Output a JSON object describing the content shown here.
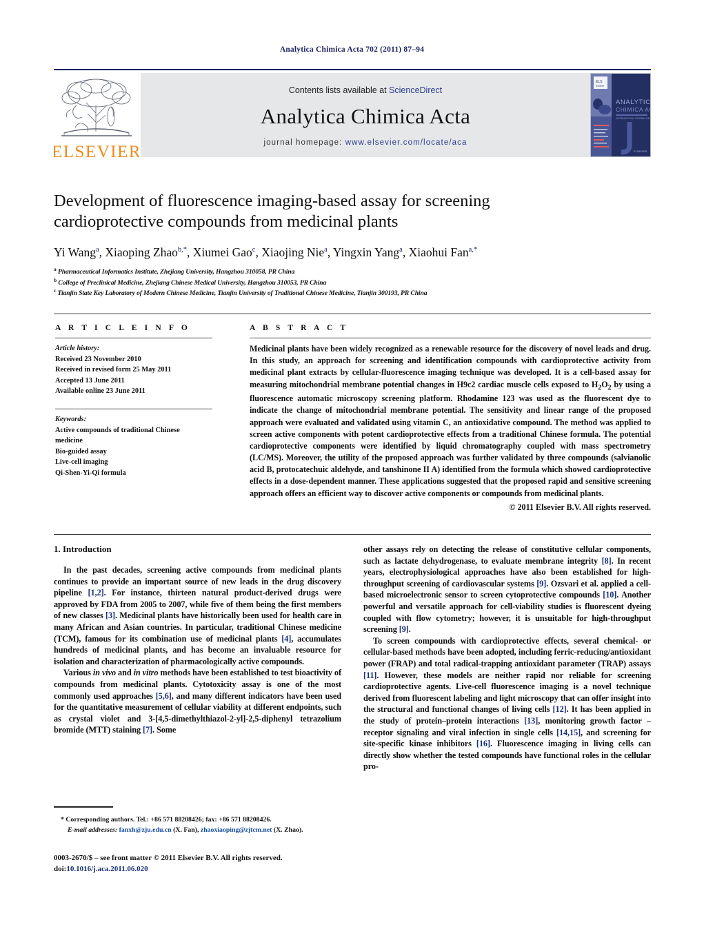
{
  "running_head": "Analytica Chimica Acta 702 (2011) 87–94",
  "masthead": {
    "contents_prefix": "Contents lists available at ",
    "sciencedirect": "ScienceDirect",
    "journal_title": "Analytica Chimica Acta",
    "homepage_prefix": "journal homepage: ",
    "homepage_url": "www.elsevier.com/locate/aca",
    "publisher_wordmark": "ELSEVIER",
    "publisher_logo": "elsevier-tree-logo",
    "cover_title_line1": "ANALYTICA",
    "cover_title_line2": "CHIMICA ACTA",
    "accent_color": "#1a2360",
    "link_color": "#2a3d8f",
    "elsevier_orange": "#f08a1c"
  },
  "title": "Development of fluorescence imaging-based assay for screening cardioprotective compounds from medicinal plants",
  "authors_html": "Yi Wang<sup>a</sup>, Xiaoping Zhao<sup>b,*</sup>, Xiumei Gao<sup>c</sup>, Xiaojing Nie<sup>a</sup>, Yingxin Yang<sup>a</sup>, Xiaohui Fan<sup>a,*</sup>",
  "affiliations": [
    "Pharmaceutical Informatics Institute, Zhejiang University, Hangzhou 310058, PR China",
    "College of Preclinical Medicine, Zhejiang Chinese Medical University, Hangzhou 310053, PR China",
    "Tianjin State Key Laboratory of Modern Chinese Medicine, Tianjin University of Traditional Chinese Medicine, Tianjin 300193, PR China"
  ],
  "affiliation_marks": [
    "a",
    "b",
    "c"
  ],
  "article_info": {
    "heading": "A R T I C L E   I N F O",
    "history_label": "Article history:",
    "history": [
      "Received 23 November 2010",
      "Received in revised form 25 May 2011",
      "Accepted 13 June 2011",
      "Available online 23 June 2011"
    ],
    "keywords_label": "Keywords:",
    "keywords": [
      "Active compounds of traditional Chinese",
      "medicine",
      "Bio-guided assay",
      "Live-cell imaging",
      "Qi-Shen-Yi-Qi formula"
    ]
  },
  "abstract": {
    "heading": "A B S T R A C T",
    "text": "Medicinal plants have been widely recognized as a renewable resource for the discovery of novel leads and drug. In this study, an approach for screening and identification compounds with cardioprotective activity from medicinal plant extracts by cellular-fluorescence imaging technique was developed. It is a cell-based assay for measuring mitochondrial membrane potential changes in H9c2 cardiac muscle cells exposed to H2O2 by using a fluorescence automatic microscopy screening platform. Rhodamine 123 was used as the fluorescent dye to indicate the change of mitochondrial membrane potential. The sensitivity and linear range of the proposed approach were evaluated and validated using vitamin C, an antioxidative compound. The method was applied to screen active components with potent cardioprotective effects from a traditional Chinese formula. The potential cardioprotective components were identified by liquid chromatography coupled with mass spectrometry (LC/MS). Moreover, the utility of the proposed approach was further validated by three compounds (salvianolic acid B, protocatechuic aldehyde, and tanshinone II A) identified from the formula which showed cardioprotective effects in a dose-dependent manner. These applications suggested that the proposed rapid and sensitive screening approach offers an efficient way to discover active components or compounds from medicinal plants.",
    "copyright": "© 2011 Elsevier B.V. All rights reserved."
  },
  "body": {
    "section_number_title": "1.  Introduction",
    "left_paragraphs": [
      "In the past decades, screening active compounds from medicinal plants continues to provide an important source of new leads in the drug discovery pipeline [1,2]. For instance, thirteen natural product-derived drugs were approved by FDA from 2005 to 2007, while five of them being the first members of new classes [3]. Medicinal plants have historically been used for health care in many African and Asian countries. In particular, traditional Chinese medicine (TCM), famous for its combination use of medicinal plants [4], accumulates hundreds of medicinal plants, and has become an invaluable resource for isolation and characterization of pharmacologically active compounds.",
      "Various in vivo and in vitro methods have been established to test bioactivity of compounds from medicinal plants. Cytotoxicity assay is one of the most commonly used approaches [5,6], and many different indicators have been used for the quantitative measurement of cellular viability at different endpoints, such as crystal violet and 3-[4,5-dimethylthiazol-2-yl]-2,5-diphenyl tetrazolium bromide (MTT) staining [7]. Some"
    ],
    "right_paragraphs": [
      "other assays rely on detecting the release of constitutive cellular components, such as lactate dehydrogenase, to evaluate membrane integrity [8]. In recent years, electrophysiological approaches have also been established for high-throughput screening of cardiovascular systems [9]. Ozsvari et al. applied a cell-based microelectronic sensor to screen cytoprotective compounds [10]. Another powerful and versatile approach for cell-viability studies is fluorescent dyeing coupled with flow cytometry; however, it is unsuitable for high-throughput screening [9].",
      "To screen compounds with cardioprotective effects, several chemical- or cellular-based methods have been adopted, including ferric-reducing/antioxidant power (FRAP) and total radical-trapping antioxidant parameter (TRAP) assays [11]. However, these models are neither rapid nor reliable for screening cardioprotective agents. Live-cell fluorescence imaging is a novel technique derived from fluorescent labeling and light microscopy that can offer insight into the structural and functional changes of living cells [12]. It has been applied in the study of protein–protein interactions [13], monitoring growth factor – receptor signaling and viral infection in single cells [14,15], and screening for site-specific kinase inhibitors [16]. Fluorescence imaging in living cells can directly show whether the tested compounds have functional roles in the cellular pro-"
    ]
  },
  "footnotes": {
    "corresponding": "* Corresponding authors. Tel.: +86 571 88208426; fax: +86 571 88208426.",
    "email_label": "E-mail addresses:",
    "email1": "fanxh@zju.edu.cn",
    "email1_owner": "(X. Fan),",
    "email2": "zhaoxiaoping@zjtcm.net",
    "email2_owner": "(X. Zhao)."
  },
  "imprint": {
    "issn_line": "0003-2670/$ – see front matter © 2011 Elsevier B.V. All rights reserved.",
    "doi_label": "doi:",
    "doi": "10.1016/j.aca.2011.06.020"
  }
}
